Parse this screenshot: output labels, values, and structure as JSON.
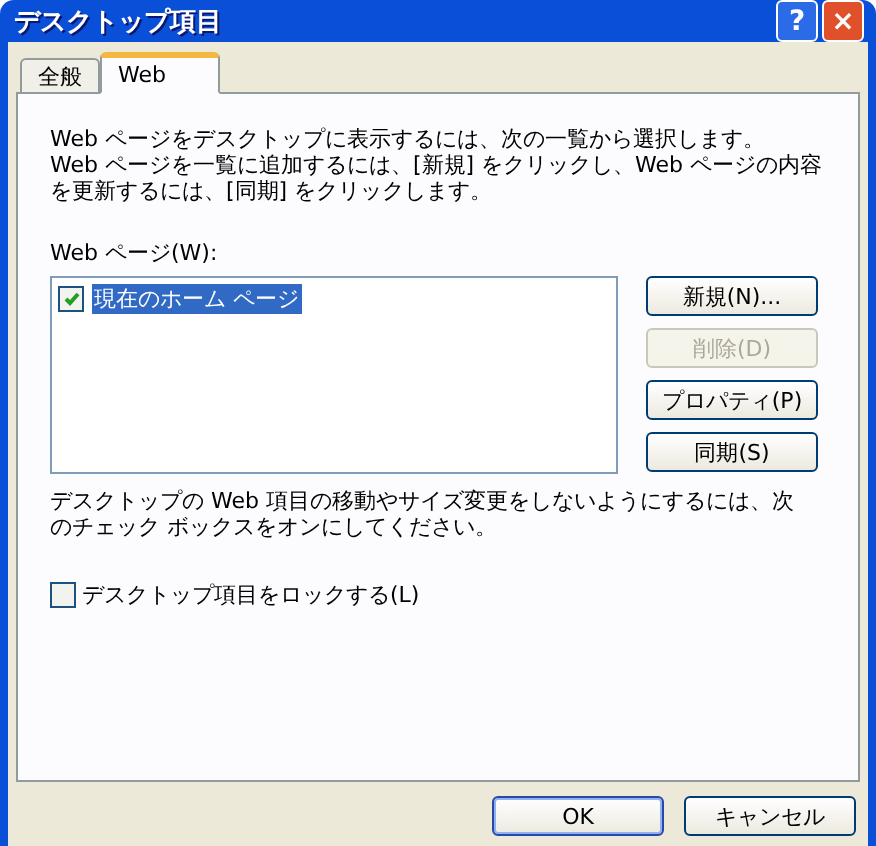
{
  "window": {
    "title": "デスクトップ項目",
    "help_button": "?",
    "close_button": "×"
  },
  "tabs": [
    {
      "label": "全般",
      "selected": false
    },
    {
      "label": "Web",
      "selected": true
    }
  ],
  "intro": [
    "Web ページをデスクトップに表示するには、次の一覧から選択します。",
    "Web ページを一覧に追加するには、[新規] をクリックし、Web ページの内容を更新するには、[同期] をクリックします。"
  ],
  "list_label": "Web ページ(W):",
  "pages": [
    {
      "label": "現在のホーム ページ",
      "checked": true,
      "selected": true
    }
  ],
  "side_buttons": [
    {
      "label": "新規(N)...",
      "disabled": false
    },
    {
      "label": "削除(D)",
      "disabled": true
    },
    {
      "label": "プロパティ(P)",
      "disabled": false
    },
    {
      "label": "同期(S)",
      "disabled": false
    }
  ],
  "lock_note": "デスクトップの Web 項目の移動やサイズ変更をしないようにするには、次のチェック ボックスをオンにしてください。",
  "lock_checkbox": {
    "label": "デスクトップ項目をロックする(L)",
    "checked": false
  },
  "buttons": [
    {
      "label": "OK",
      "default": true
    },
    {
      "label": "キャンセル",
      "default": false
    }
  ]
}
